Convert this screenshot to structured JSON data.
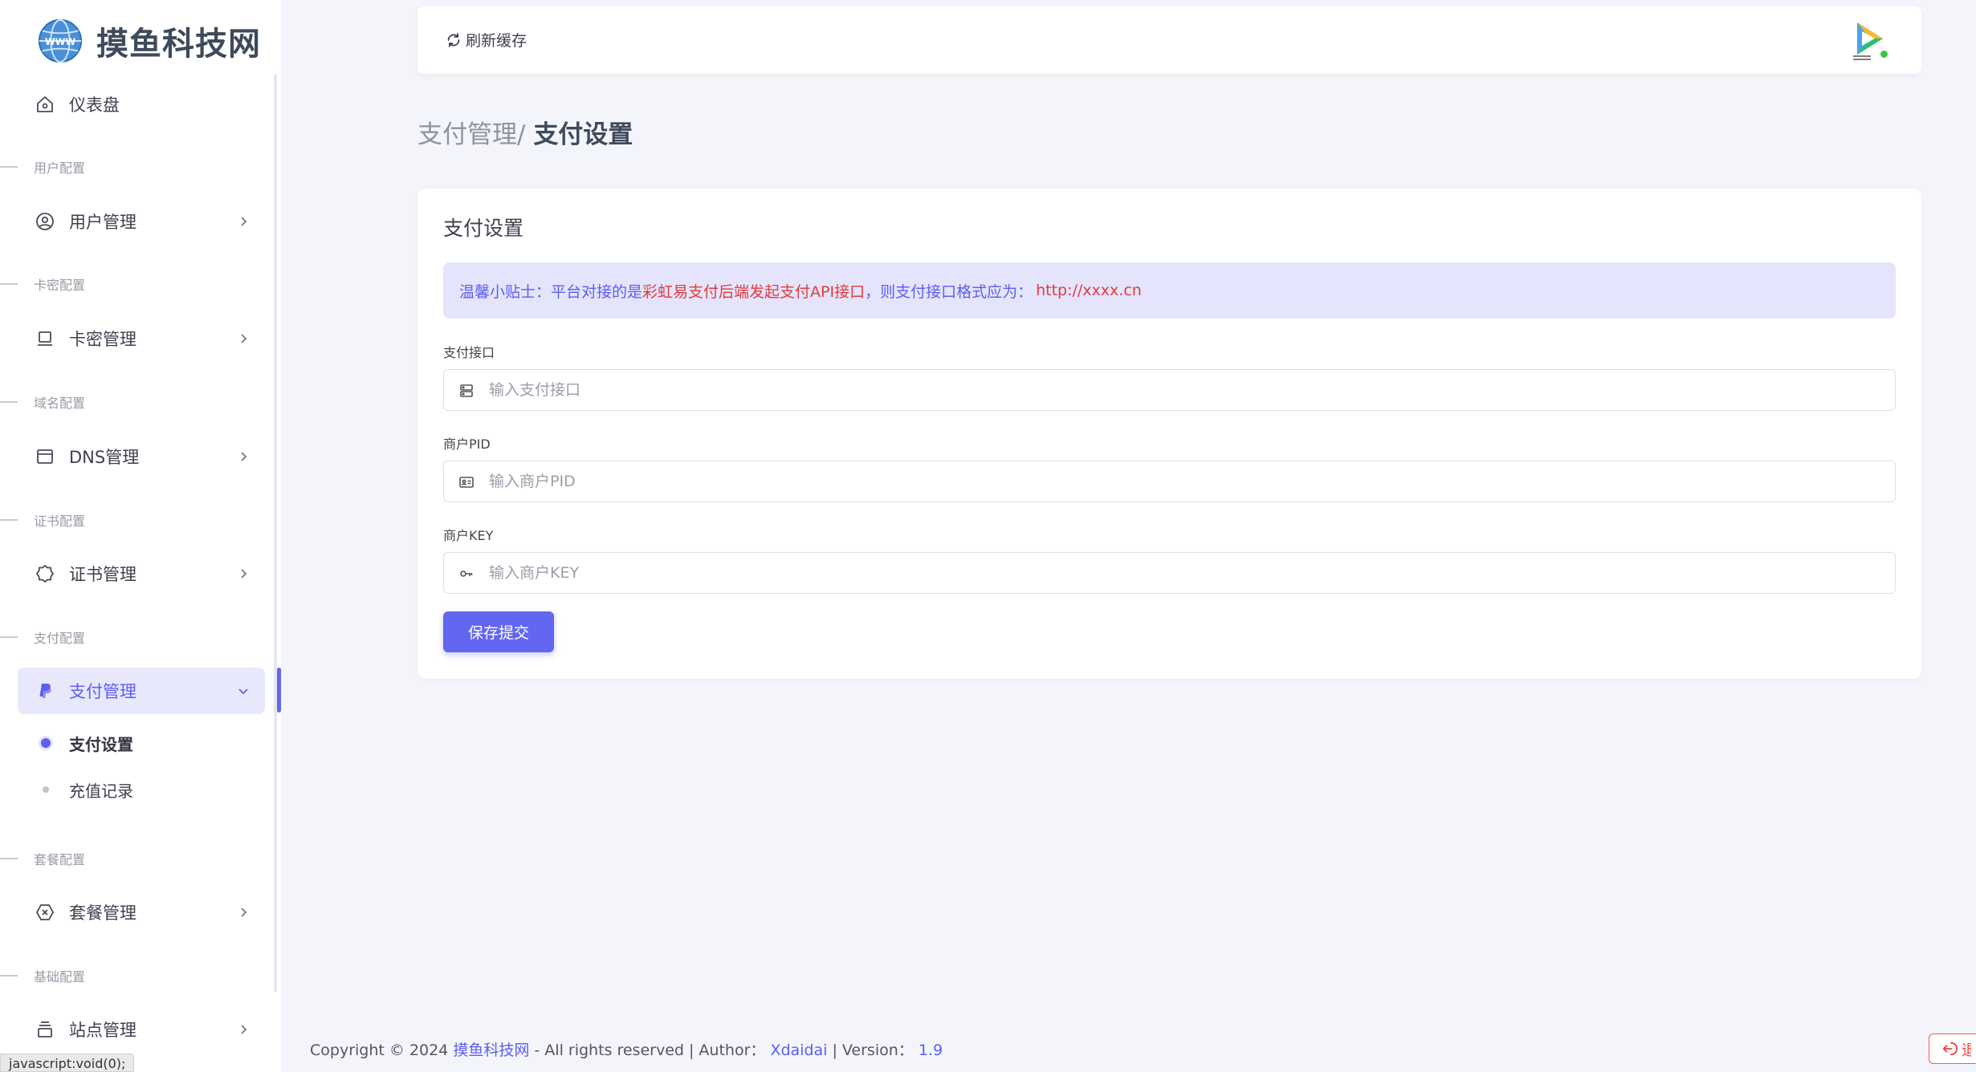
{
  "brand": {
    "name": "摸鱼科技网"
  },
  "sidebar": {
    "dashboard": {
      "label": "仪表盘"
    },
    "sections": [
      {
        "title": "用户配置",
        "item": {
          "label": "用户管理"
        }
      },
      {
        "title": "卡密配置",
        "item": {
          "label": "卡密管理"
        }
      },
      {
        "title": "域名配置",
        "item": {
          "label": "DNS管理"
        }
      },
      {
        "title": "证书配置",
        "item": {
          "label": "证书管理"
        }
      },
      {
        "title": "支付配置",
        "item": {
          "label": "支付管理"
        },
        "subitems": [
          {
            "label": "支付设置",
            "active": true
          },
          {
            "label": "充值记录",
            "active": false
          }
        ]
      },
      {
        "title": "套餐配置",
        "item": {
          "label": "套餐管理"
        }
      },
      {
        "title": "基础配置",
        "item": {
          "label": "站点管理"
        }
      }
    ]
  },
  "status_bar": {
    "url": "javascript:void(0);"
  },
  "topbar": {
    "refresh_label": "刷新缓存"
  },
  "breadcrumb": {
    "parent": "支付管理/",
    "current": "支付设置"
  },
  "card": {
    "title": "支付设置",
    "alert": {
      "prefix": "温馨小贴士：平台对接的是",
      "highlight": "彩虹易支付后端发起支付API接口",
      "middle": "，则支付接口格式应为：",
      "example": "http://xxxx.cn"
    },
    "fields": [
      {
        "label": "支付接口",
        "placeholder": "输入支付接口",
        "value": ""
      },
      {
        "label": "商户PID",
        "placeholder": "输入商户PID",
        "value": ""
      },
      {
        "label": "商户KEY",
        "placeholder": "输入商户KEY",
        "value": ""
      }
    ],
    "submit_label": "保存提交"
  },
  "footer": {
    "copyright": "Copyright © 2024",
    "site_link": "摸鱼科技网",
    "rights": "- All rights reserved | Author：",
    "author": "Xdaidai",
    "version_label": "| Version：",
    "version": "1.9"
  },
  "logout": {
    "label": "退出"
  },
  "colors": {
    "accent": "#6366f1",
    "danger": "#e23b3b",
    "alert_bg": "#e4e4fd",
    "page_bg": "#f4f5fa"
  }
}
